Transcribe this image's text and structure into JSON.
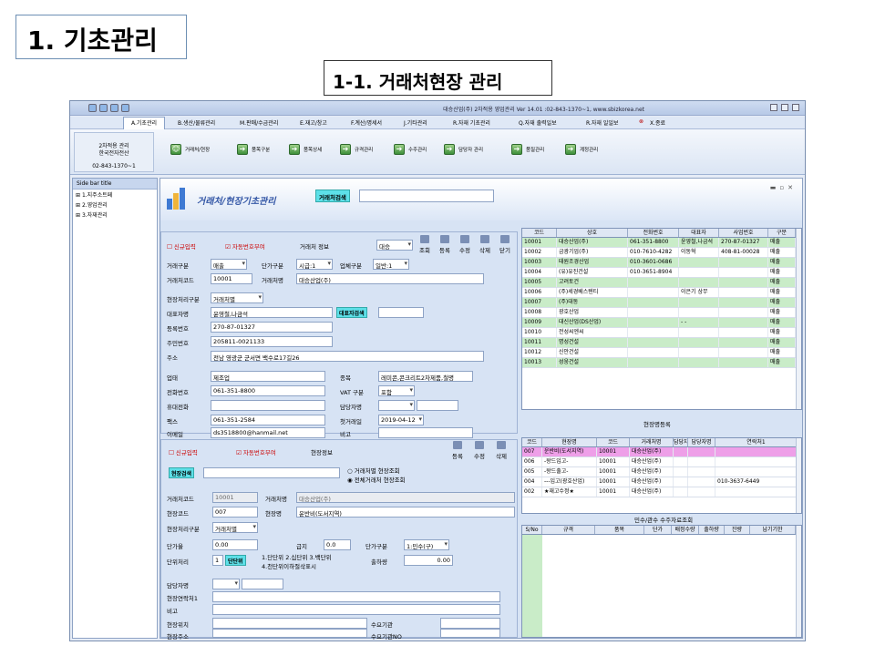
{
  "slide": {
    "title": "1. 기초관리",
    "subtitle": "1-1. 거래처현장 관리"
  },
  "window": {
    "title": "대승산업(주) 2차적용 영업관리 Ver 14.01 :02-843-1370~1, www.sbizkorea.net"
  },
  "menu": [
    "A.기초관리",
    "B.생산/물류관리",
    "M.판매/수금관리",
    "E.재고/창고",
    "F.계산/명세서",
    "J.기타관리",
    "R.자재 기초관리",
    "Q.자재 출력일보",
    "R.자재 일일보",
    "X.종료"
  ],
  "ribbon": {
    "company": [
      "2차적용 관리",
      "한국전자전산"
    ],
    "tel": "02-843-1370~1",
    "items": [
      "거래처/현장",
      "품목구분",
      "품목상세",
      "규격관리",
      "수주관리",
      "담당자 관리",
      "품질관리",
      "계정관리"
    ]
  },
  "sidebar": {
    "title": "Side bar title",
    "items": [
      "1.지주소트페",
      "2.영업관리",
      "3.자재관리"
    ]
  },
  "header": {
    "title": "거래처/현장기초관리",
    "search_label": "거래처검색"
  },
  "client": {
    "chk_new": "신규입력",
    "chk_auto": "자동번호부여",
    "section": "거래처 정보",
    "type_val": "대승",
    "buttons": [
      "조회",
      "등록",
      "수정",
      "삭제",
      "닫기"
    ],
    "rows": {
      "kind_label": "거래구분",
      "kind_val": "매출",
      "price_label": "단가구분",
      "price_val": "시급:1",
      "biz_label": "업체구분",
      "biz_val": "일반:1",
      "code_label": "거래처코드",
      "code_val": "10001",
      "name_label": "거래처명",
      "name_val": "대승산업(주)",
      "site_label": "현장처리구분",
      "site_val": "거래처별",
      "ceo_label": "대표자명",
      "ceo_val": "윤영철,나금석",
      "ceo_btn": "대표자검색",
      "reg_label": "등록번호",
      "reg_val": "270-87-01327",
      "jumin_label": "주민번호",
      "jumin_val": "205811-0021133",
      "addr_label": "주소",
      "addr_val": "전남 영광군 군서면 백수로17길26",
      "biztype_label": "업태",
      "biztype_val": "제조업",
      "item_label": "종목",
      "item_val": "레미콘,콘크리트2차제품,철명",
      "tel_label": "전화번호",
      "tel_val": "061-351-8800",
      "vat_label": "VAT 구분",
      "vat_val": "포함",
      "mobile_label": "휴대전화",
      "mobile_val": "",
      "mgr_label": "담당자명",
      "mgr_val": "",
      "fax_label": "팩스",
      "fax_val": "061-351-2584",
      "first_label": "첫거래일",
      "first_val": "2019-04-12",
      "email_label": "이메일",
      "email_val": "ds3518800@hanmail.net",
      "memo_label": "비고",
      "memo_val": ""
    }
  },
  "site": {
    "chk_new": "신규입력",
    "chk_auto": "자동번호부여",
    "section": "현장정보",
    "buttons": [
      "등록",
      "수정",
      "삭제"
    ],
    "search_label": "현장검색",
    "radio1": "거래처별 현장조회",
    "radio2": "전체거래처 현장조회",
    "code_label": "거래처코드",
    "code_val": "10001",
    "name_label": "거래처명",
    "name_val": "대승산업(주)",
    "scode_label": "현장코드",
    "scode_val": "007",
    "sname_label": "현장명",
    "sname_val": "운반비(도서지역)",
    "proc_label": "현장처리구분",
    "proc_val": "거래처별",
    "rate_label": "단가율",
    "rate_val": "0.00",
    "pay_label": "급지",
    "pay_val": "0.0",
    "ptype_label": "단가구분",
    "ptype_val": "1:민수(구)",
    "unit_label": "단위처리",
    "unit_val": "1",
    "unit_btn": "단단위",
    "unit_desc1": "1.단단위 2.십단위 3.백단위",
    "unit_desc2": "4.천단위이하절삭표시",
    "ship_label": "출하량",
    "ship_val": "0.00",
    "mgr_label": "담당자명",
    "contact_label": "현장연락처1",
    "memo_label": "비고",
    "loc_label": "현장위치",
    "addr_label": "현장주소",
    "demand_label": "수요기관",
    "demand_no_label": "수요기관NO"
  },
  "client_grid": {
    "headers": [
      "코드",
      "상호",
      "전화번호",
      "대표자",
      "사업번호",
      "구분"
    ],
    "rows": [
      [
        "10001",
        "대승산업(주)",
        "061-351-8800",
        "윤영철,나금석",
        "270-87-01327",
        "매출"
      ],
      [
        "10002",
        "금광기업(주)",
        "010-7610-4282",
        "이동혁",
        "408-81-00028",
        "매출"
      ],
      [
        "10003",
        "태원조경산업",
        "010-3601-0686",
        "",
        "",
        "매출"
      ],
      [
        "10004",
        "(유)유진건설",
        "010-3651-8904",
        "",
        "",
        "매출"
      ],
      [
        "10005",
        "고려토건",
        "",
        "",
        "",
        "매출"
      ],
      [
        "10006",
        "(주)세경베스텐티",
        "",
        "이은기 상무",
        "",
        "매출"
      ],
      [
        "10007",
        "(주)대동",
        "",
        "",
        "",
        "매출"
      ],
      [
        "10008",
        "광호산업",
        "",
        "",
        "",
        "매출"
      ],
      [
        "10009",
        "대신산업(DS산업)",
        "",
        "- -",
        "",
        "매출"
      ],
      [
        "10010",
        "전성씨엔씨",
        "",
        "",
        "",
        "매출"
      ],
      [
        "10011",
        "명성건설",
        "",
        "",
        "",
        "매출"
      ],
      [
        "10012",
        "신안건설",
        "",
        "",
        "",
        "매출"
      ],
      [
        "10013",
        "성웅건설",
        "",
        "",
        "",
        "매출"
      ]
    ]
  },
  "site_grid": {
    "caption": "현장명등록",
    "headers": [
      "코드",
      "현장명",
      "코드",
      "거래처명",
      "담당자",
      "담당자명",
      "연락처1"
    ],
    "rows": [
      [
        "007",
        "운반비(도서지역)",
        "10001",
        "대승산업(주)",
        "",
        "",
        ""
      ],
      [
        "006",
        "-왕드입고-",
        "10001",
        "대승산업(주)",
        "",
        "",
        ""
      ],
      [
        "005",
        "-왕드출고-",
        "10001",
        "대승산업(주)",
        "",
        "",
        ""
      ],
      [
        "004",
        "---입고(광호산업)",
        "10001",
        "대승산업(주)",
        "",
        "",
        "010-3637-6449"
      ],
      [
        "002",
        "★재고수정★",
        "10001",
        "대승산업(주)",
        "",
        "",
        ""
      ]
    ],
    "footer": "민수/관수 수주자료조회"
  },
  "order_grid": {
    "headers": [
      "S/No",
      "규격",
      "품목",
      "단가",
      "배정수량",
      "출하량",
      "잔량",
      "납기기한"
    ]
  }
}
